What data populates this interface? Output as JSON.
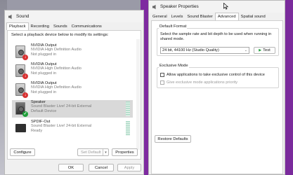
{
  "sound": {
    "title": "Sound",
    "tabs": [
      "Playback",
      "Recording",
      "Sounds",
      "Communications"
    ],
    "instruction": "Select a playback device below to modify its settings:",
    "devices": [
      {
        "name": "NVIDIA Output",
        "sub": "NVIDIA High Definition Audio",
        "status": "Not plugged in",
        "badge": "red"
      },
      {
        "name": "NVIDIA Output",
        "sub": "NVIDIA High Definition Audio",
        "status": "Not plugged in",
        "badge": "red"
      },
      {
        "name": "NVIDIA Output",
        "sub": "NVIDIA High Definition Audio",
        "status": "Not plugged in",
        "badge": "red"
      },
      {
        "name": "Speaker",
        "sub": "Sound Blaster Live! 24-bit External",
        "status": "Default Device",
        "badge": "green"
      },
      {
        "name": "SPDIF-Out",
        "sub": "Sound Blaster Live! 24-bit External",
        "status": "Ready",
        "badge": ""
      }
    ],
    "configure_label": "Configure",
    "set_default_label": "Set Default",
    "properties_label": "Properties",
    "ok_label": "OK",
    "cancel_label": "Cancel",
    "apply_label": "Apply"
  },
  "props": {
    "title": "Speaker Properties",
    "tabs": [
      "General",
      "Levels",
      "Sound Blaster",
      "Advanced",
      "Spatial sound"
    ],
    "default_format": {
      "group_label": "Default Format",
      "description": "Select the sample rate and bit depth to be used when running in shared mode.",
      "selected": "24 bit, 44100 Hz (Studio Quality)",
      "test_label": "Test"
    },
    "exclusive": {
      "group_label": "Exclusive Mode",
      "allow_label": "Allow applications to take exclusive control of this device",
      "priority_label": "Give exclusive mode applications priority"
    },
    "restore_label": "Restore Defaults"
  },
  "colors": {
    "accent": "#1f9f3a",
    "error": "#d83232",
    "selection": "#d9d9d9"
  }
}
